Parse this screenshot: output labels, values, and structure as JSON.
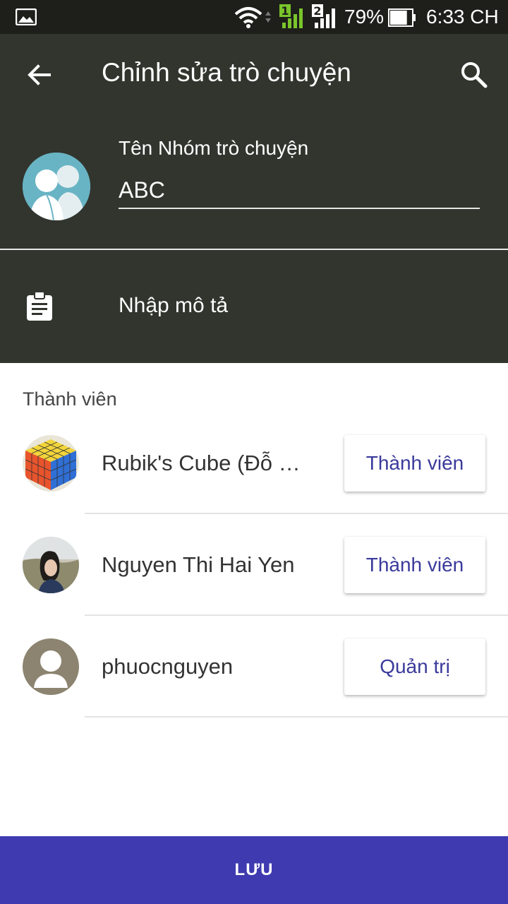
{
  "status_bar": {
    "battery_percent": "79%",
    "time": "6:33 CH",
    "sim1_label": "1",
    "sim2_label": "2",
    "battery_level": 0.79
  },
  "header": {
    "title": "Chỉnh sửa trò chuyện",
    "group_name_label": "Tên Nhóm trò chuyện",
    "group_name_value": "ABC",
    "description_placeholder": "Nhập mô tả"
  },
  "icons": {
    "back": "arrow-left-icon",
    "search": "search-icon",
    "clipboard": "clipboard-icon",
    "gallery": "image-icon",
    "wifi": "wifi-icon",
    "battery": "battery-icon"
  },
  "members": {
    "section_label": "Thành viên",
    "items": [
      {
        "name": "Rubik's Cube (Đỗ Hoàng)",
        "role": "Thành viên"
      },
      {
        "name": "Nguyen Thi Hai Yen",
        "role": "Thành viên"
      },
      {
        "name": "phuocnguyen",
        "role": "Quản trị"
      }
    ]
  },
  "save_button": {
    "label": "LƯU"
  },
  "colors": {
    "header_bg": "#32352e",
    "status_bg": "#1e1f1b",
    "accent": "#3f3ab0",
    "role_text": "#3a3a9c",
    "signal_green": "#7ac52b"
  }
}
